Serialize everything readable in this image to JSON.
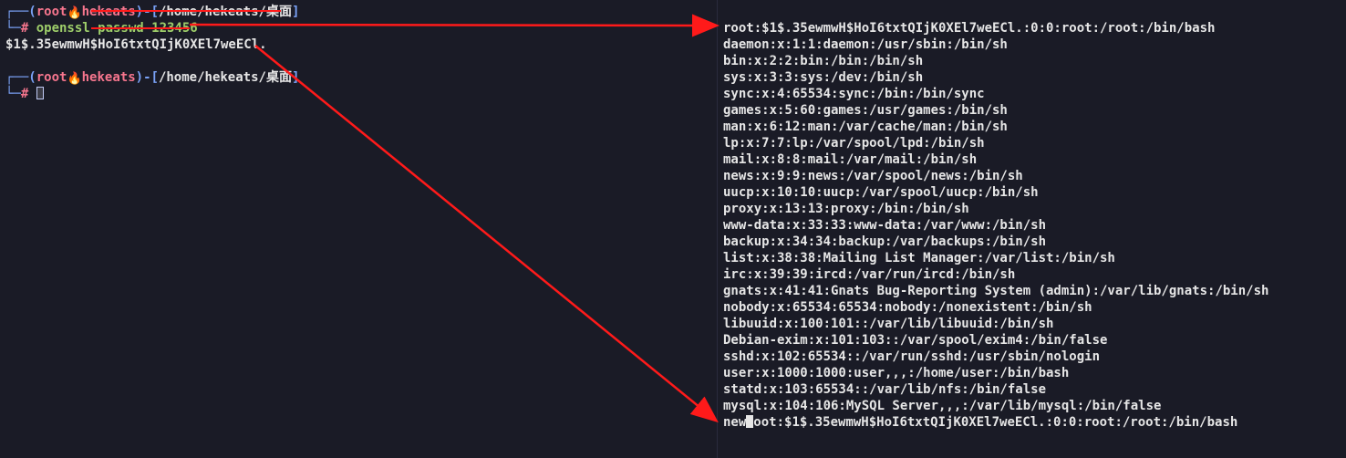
{
  "left": {
    "prompt1": {
      "user": "root",
      "host": "hekeats",
      "path": "/home/hekeats/桌面",
      "cmd": "openssl passwd 123456"
    },
    "output": "$1$.35ewmwH$HoI6txtQIjK0XEl7weECl.",
    "prompt2": {
      "user": "root",
      "host": "hekeats",
      "path": "/home/hekeats/桌面"
    },
    "fire_icon": "🔥"
  },
  "right": {
    "lines": [
      "root:$1$.35ewmwH$HoI6txtQIjK0XEl7weECl.:0:0:root:/root:/bin/bash",
      "daemon:x:1:1:daemon:/usr/sbin:/bin/sh",
      "bin:x:2:2:bin:/bin:/bin/sh",
      "sys:x:3:3:sys:/dev:/bin/sh",
      "sync:x:4:65534:sync:/bin:/bin/sync",
      "games:x:5:60:games:/usr/games:/bin/sh",
      "man:x:6:12:man:/var/cache/man:/bin/sh",
      "lp:x:7:7:lp:/var/spool/lpd:/bin/sh",
      "mail:x:8:8:mail:/var/mail:/bin/sh",
      "news:x:9:9:news:/var/spool/news:/bin/sh",
      "uucp:x:10:10:uucp:/var/spool/uucp:/bin/sh",
      "proxy:x:13:13:proxy:/bin:/bin/sh",
      "www-data:x:33:33:www-data:/var/www:/bin/sh",
      "backup:x:34:34:backup:/var/backups:/bin/sh",
      "list:x:38:38:Mailing List Manager:/var/list:/bin/sh",
      "irc:x:39:39:ircd:/var/run/ircd:/bin/sh",
      "gnats:x:41:41:Gnats Bug-Reporting System (admin):/var/lib/gnats:/bin/sh",
      "nobody:x:65534:65534:nobody:/nonexistent:/bin/sh",
      "libuuid:x:100:101::/var/lib/libuuid:/bin/sh",
      "Debian-exim:x:101:103::/var/spool/exim4:/bin/false",
      "sshd:x:102:65534::/var/run/sshd:/usr/sbin/nologin",
      "user:x:1000:1000:user,,,:/home/user:/bin/bash",
      "statd:x:103:65534::/var/lib/nfs:/bin/false",
      "mysql:x:104:106:MySQL Server,,,:/var/lib/mysql:/bin/false"
    ],
    "last_line_prefix": "new",
    "last_line_cursor_char": "r",
    "last_line_suffix": "oot:$1$.35ewmwH$HoI6txtQIjK0XEl7weECl.:0:0:root:/root:/bin/bash"
  }
}
